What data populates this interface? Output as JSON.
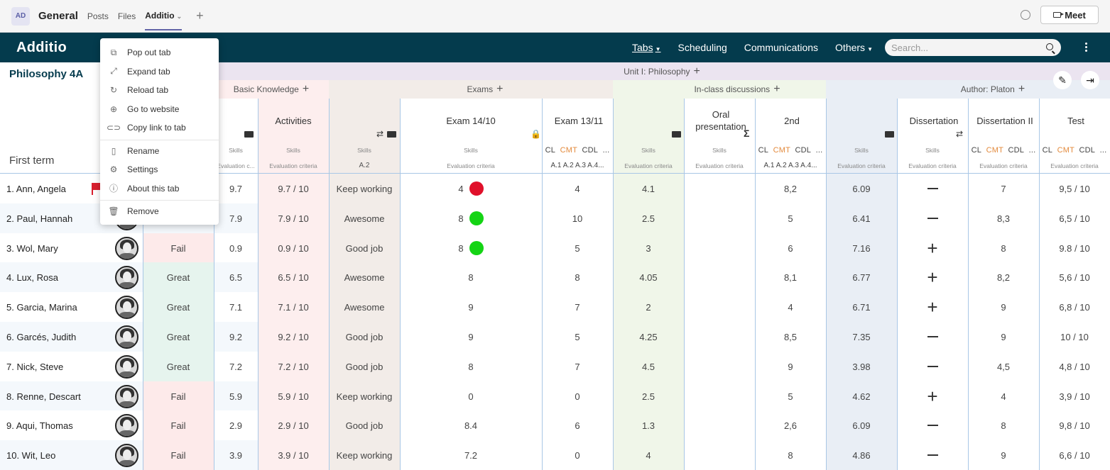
{
  "teams": {
    "avatar": "AD",
    "channel": "General",
    "tabs": [
      "Posts",
      "Files",
      "Additio"
    ],
    "meet": "Meet"
  },
  "nav": {
    "logo": "Additio",
    "links": [
      "Tabs",
      "Scheduling",
      "Communications",
      "Others"
    ],
    "search_placeholder": "Search..."
  },
  "menu": {
    "items": [
      {
        "label": "Pop out tab",
        "icon": "pop-out-icon"
      },
      {
        "label": "Expand tab",
        "icon": "expand-icon"
      },
      {
        "label": "Reload tab",
        "icon": "reload-icon"
      },
      {
        "label": "Go to website",
        "icon": "globe-icon"
      },
      {
        "label": "Copy link to tab",
        "icon": "link-icon"
      },
      {
        "label": "Rename",
        "icon": "rename-icon"
      },
      {
        "label": "Settings",
        "icon": "gear-icon"
      },
      {
        "label": "About this tab",
        "icon": "info-icon"
      },
      {
        "label": "Remove",
        "icon": "trash-icon"
      }
    ]
  },
  "grid": {
    "class_title": "Philosophy 4A",
    "term": "First term",
    "unit": "Unit I: Philosophy",
    "groups": {
      "basic": "Basic Knowledge",
      "exams": "Exams",
      "discussions": "In-class discussions",
      "author": "Author: Platon"
    },
    "columns": {
      "activities": "Activities",
      "exam1": "Exam 14/10",
      "exam2": "Exam 13/11",
      "oral": "Oral presentation",
      "second": "2nd",
      "diss1": "Dissertation",
      "diss2": "Dissertation II",
      "test": "Test"
    },
    "sub": {
      "skills": "Skills",
      "eval": "Evaluation criteria",
      "eval_trunc": "Evaluation c...",
      "a2": "A.2",
      "codes_cl": "CL",
      "codes_cmt": "CMT",
      "codes_cdl": "CDL",
      "codes_more": "...",
      "crit_a": "A.1  A.2  A.3  A.4..."
    },
    "colors": {
      "unit_band": "#ebe4f0",
      "basic_pink": "#fdeeee",
      "exams_beige": "#f2ece8",
      "discussion_green": "#f0f6e9",
      "author_blue": "#e9eef5",
      "great_green": "#e6f4ee",
      "fail_red": "#fdeaea",
      "dot_red": "#e0102a",
      "dot_green": "#14d414"
    },
    "rows": [
      {
        "name": "1. Ann, Angela",
        "status": "",
        "skill": "9.7",
        "activities": "9.7 / 10",
        "comment": "Keep working",
        "exam1": "4",
        "dot": "red",
        "exam2": "4",
        "disc": "4.1",
        "oral": "",
        "second": "8,2",
        "avg": "6.09",
        "diss1": "minus",
        "diss2": "7",
        "test": "9,5 / 10",
        "flag": true
      },
      {
        "name": "2. Paul, Hannah",
        "status": "",
        "skill": "7.9",
        "activities": "7.9 / 10",
        "comment": "Awesome",
        "exam1": "8",
        "dot": "green",
        "exam2": "10",
        "disc": "2.5",
        "oral": "",
        "second": "5",
        "avg": "6.41",
        "diss1": "minus",
        "diss2": "8,3",
        "test": "6,5 / 10"
      },
      {
        "name": "3. Wol, Mary",
        "status": "Fail",
        "skill": "0.9",
        "activities": "0.9 / 10",
        "comment": "Good job",
        "exam1": "8",
        "dot": "green",
        "exam2": "5",
        "disc": "3",
        "oral": "",
        "second": "6",
        "avg": "7.16",
        "diss1": "plus",
        "diss2": "8",
        "test": "9.8 / 10"
      },
      {
        "name": "4. Lux, Rosa",
        "status": "Great",
        "skill": "6.5",
        "activities": "6.5 / 10",
        "comment": "Awesome",
        "exam1": "8",
        "dot": "",
        "exam2": "8",
        "disc": "4.05",
        "oral": "",
        "second": "8,1",
        "avg": "6.77",
        "diss1": "plus",
        "diss2": "8,2",
        "test": "5,6 / 10"
      },
      {
        "name": "5. Garcia, Marina",
        "status": "Great",
        "skill": "7.1",
        "activities": "7.1 / 10",
        "comment": "Awesome",
        "exam1": "9",
        "dot": "",
        "exam2": "7",
        "disc": "2",
        "oral": "",
        "second": "4",
        "avg": "6.71",
        "diss1": "plus",
        "diss2": "9",
        "test": "6,8 / 10"
      },
      {
        "name": "6. Garcés, Judith",
        "status": "Great",
        "skill": "9.2",
        "activities": "9.2 / 10",
        "comment": "Good job",
        "exam1": "9",
        "dot": "",
        "exam2": "5",
        "disc": "4.25",
        "oral": "",
        "second": "8,5",
        "avg": "7.35",
        "diss1": "minus",
        "diss2": "9",
        "test": "10 / 10"
      },
      {
        "name": "7. Nick, Steve",
        "status": "Great",
        "skill": "7.2",
        "activities": "7.2 / 10",
        "comment": "Good job",
        "exam1": "8",
        "dot": "",
        "exam2": "7",
        "disc": "4.5",
        "oral": "",
        "second": "9",
        "avg": "3.98",
        "diss1": "minus",
        "diss2": "4,5",
        "test": "4,8 / 10"
      },
      {
        "name": "8. Renne, Descart",
        "status": "Fail",
        "skill": "5.9",
        "activities": "5.9 / 10",
        "comment": "Keep working",
        "exam1": "0",
        "dot": "",
        "exam2": "0",
        "disc": "2.5",
        "oral": "",
        "second": "5",
        "avg": "4.62",
        "diss1": "plus",
        "diss2": "4",
        "test": "3,9 / 10"
      },
      {
        "name": "9. Aqui, Thomas",
        "status": "Fail",
        "skill": "2.9",
        "activities": "2.9 / 10",
        "comment": "Good job",
        "exam1": "8.4",
        "dot": "",
        "exam2": "6",
        "disc": "1.3",
        "oral": "",
        "second": "2,6",
        "avg": "6.09",
        "diss1": "minus",
        "diss2": "8",
        "test": "9,8 / 10"
      },
      {
        "name": "10. Wit, Leo",
        "status": "Fail",
        "skill": "3.9",
        "activities": "3.9 / 10",
        "comment": "Keep working",
        "exam1": "7.2",
        "dot": "",
        "exam2": "0",
        "disc": "4",
        "oral": "",
        "second": "8",
        "avg": "4.86",
        "diss1": "minus",
        "diss2": "9",
        "test": "6,6 / 10"
      }
    ]
  }
}
